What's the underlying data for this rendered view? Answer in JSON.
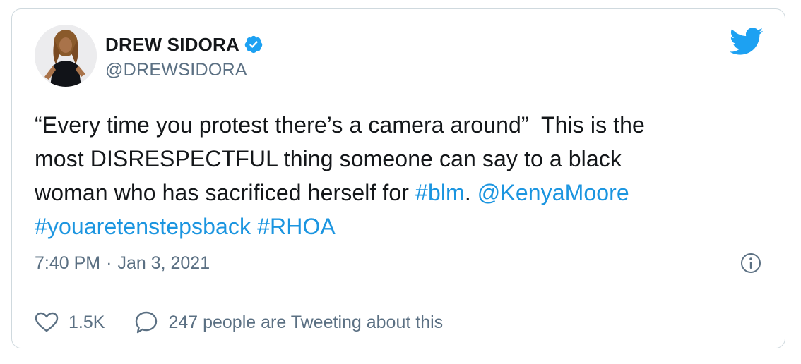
{
  "author": {
    "display_name": "DREW SIDORA",
    "handle": "@DREWSIDORA",
    "verified": true
  },
  "tweet": {
    "lines": [
      [
        {
          "text": "“Every time you protest there’s a camera around”  This is the",
          "kind": "text"
        }
      ],
      [
        {
          "text": "most DISRESPECTFUL thing someone can say to a black",
          "kind": "text"
        }
      ],
      [
        {
          "text": "woman who has sacrificed herself for ",
          "kind": "text"
        },
        {
          "text": "#blm",
          "kind": "hashtag"
        },
        {
          "text": ". ",
          "kind": "text"
        },
        {
          "text": "@KenyaMoore",
          "kind": "mention"
        }
      ],
      [
        {
          "text": "#youaretenstepsback",
          "kind": "hashtag"
        },
        {
          "text": " ",
          "kind": "text"
        },
        {
          "text": "#RHOA",
          "kind": "hashtag"
        }
      ]
    ],
    "time": "7:40 PM",
    "separator": "·",
    "date": "Jan 3, 2021"
  },
  "actions": {
    "likes": "1.5K",
    "conversation": "247 people are Tweeting about this"
  },
  "colors": {
    "link": "#1b95e0",
    "twitter_blue": "#1da1f2",
    "muted": "#5b7083",
    "text": "#14171a",
    "border": "#cfd9de"
  },
  "icons": {
    "verified": "verified-badge-icon",
    "brand": "twitter-bird-icon",
    "info": "info-icon",
    "like": "heart-icon",
    "reply": "speech-bubble-icon"
  }
}
